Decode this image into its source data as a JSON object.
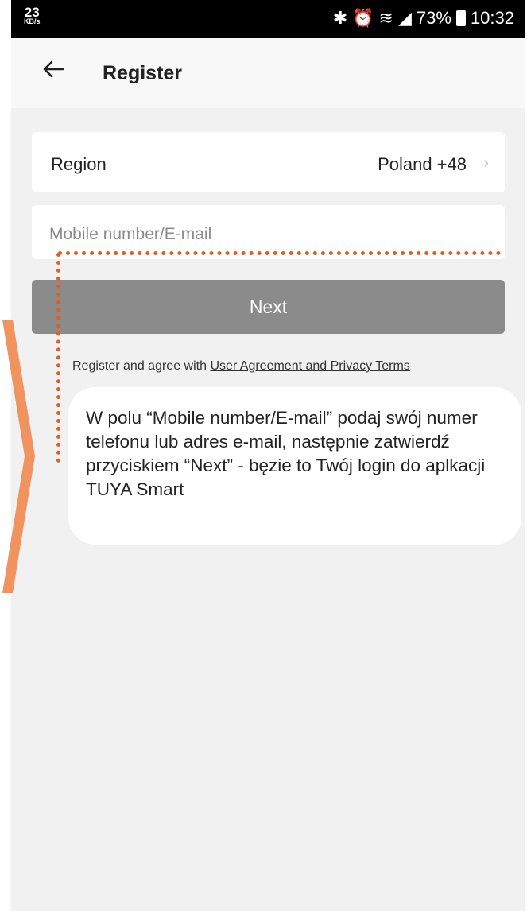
{
  "status_bar": {
    "speed": "23",
    "speed_unit": "KB/s",
    "battery": "73%",
    "time": "10:32"
  },
  "header": {
    "title": "Register"
  },
  "region": {
    "label": "Region",
    "value": "Poland +48"
  },
  "mobile_field": {
    "placeholder": "Mobile number/E-mail",
    "value": ""
  },
  "next_button": {
    "label": "Next"
  },
  "agreement": {
    "text": "Register and agree with ",
    "link": "User Agreement and Privacy Terms"
  },
  "annotation": {
    "text": "W polu “Mobile number/E-mail” podaj swój numer telefonu lub adres e-mail, następnie zatwierdź przyciskiem “Next” - bęzie to Twój login do aplkacji TUYA Smart"
  },
  "colors": {
    "accent_orange": "#f0935f",
    "dotted_line": "#e05e22",
    "button_gray": "#8b8b8b"
  }
}
